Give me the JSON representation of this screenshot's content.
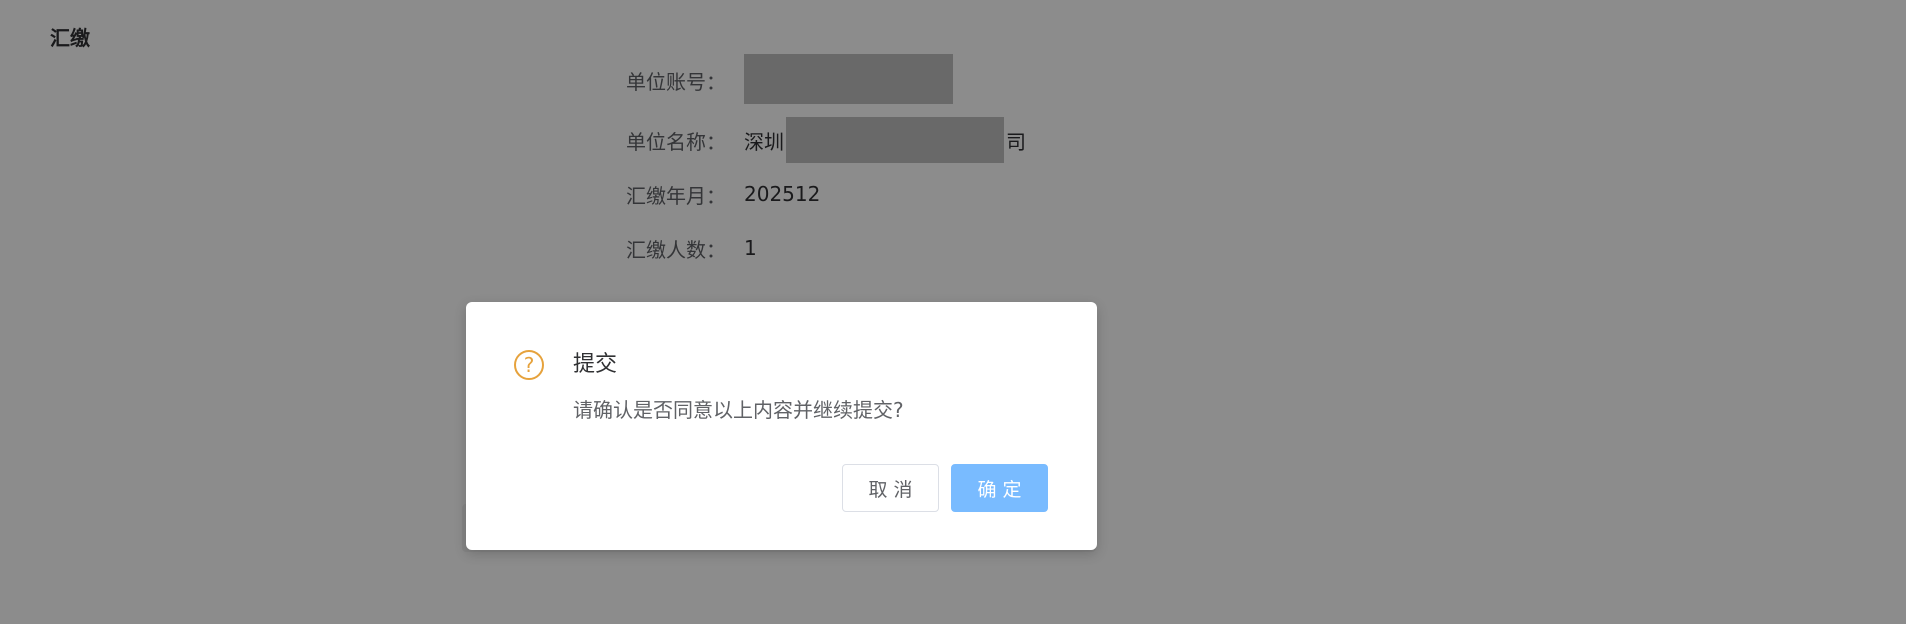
{
  "page": {
    "title": "汇缴"
  },
  "form": {
    "account_label": "单位账号：",
    "account_value": "",
    "name_label": "单位名称：",
    "name_prefix": "深圳",
    "name_suffix": "司",
    "period_label": "汇缴年月：",
    "period_value": "202512",
    "count_label": "汇缴人数：",
    "count_value": "1"
  },
  "dialog": {
    "icon": "question-circle-icon",
    "icon_glyph": "?",
    "title": "提交",
    "message": "请确认是否同意以上内容并继续提交?",
    "cancel_label": "取消",
    "confirm_label": "确定"
  },
  "colors": {
    "warning": "#E6A23C",
    "primary_disabled": "#79bbff",
    "mask": "rgba(0,0,0,0.45)"
  }
}
